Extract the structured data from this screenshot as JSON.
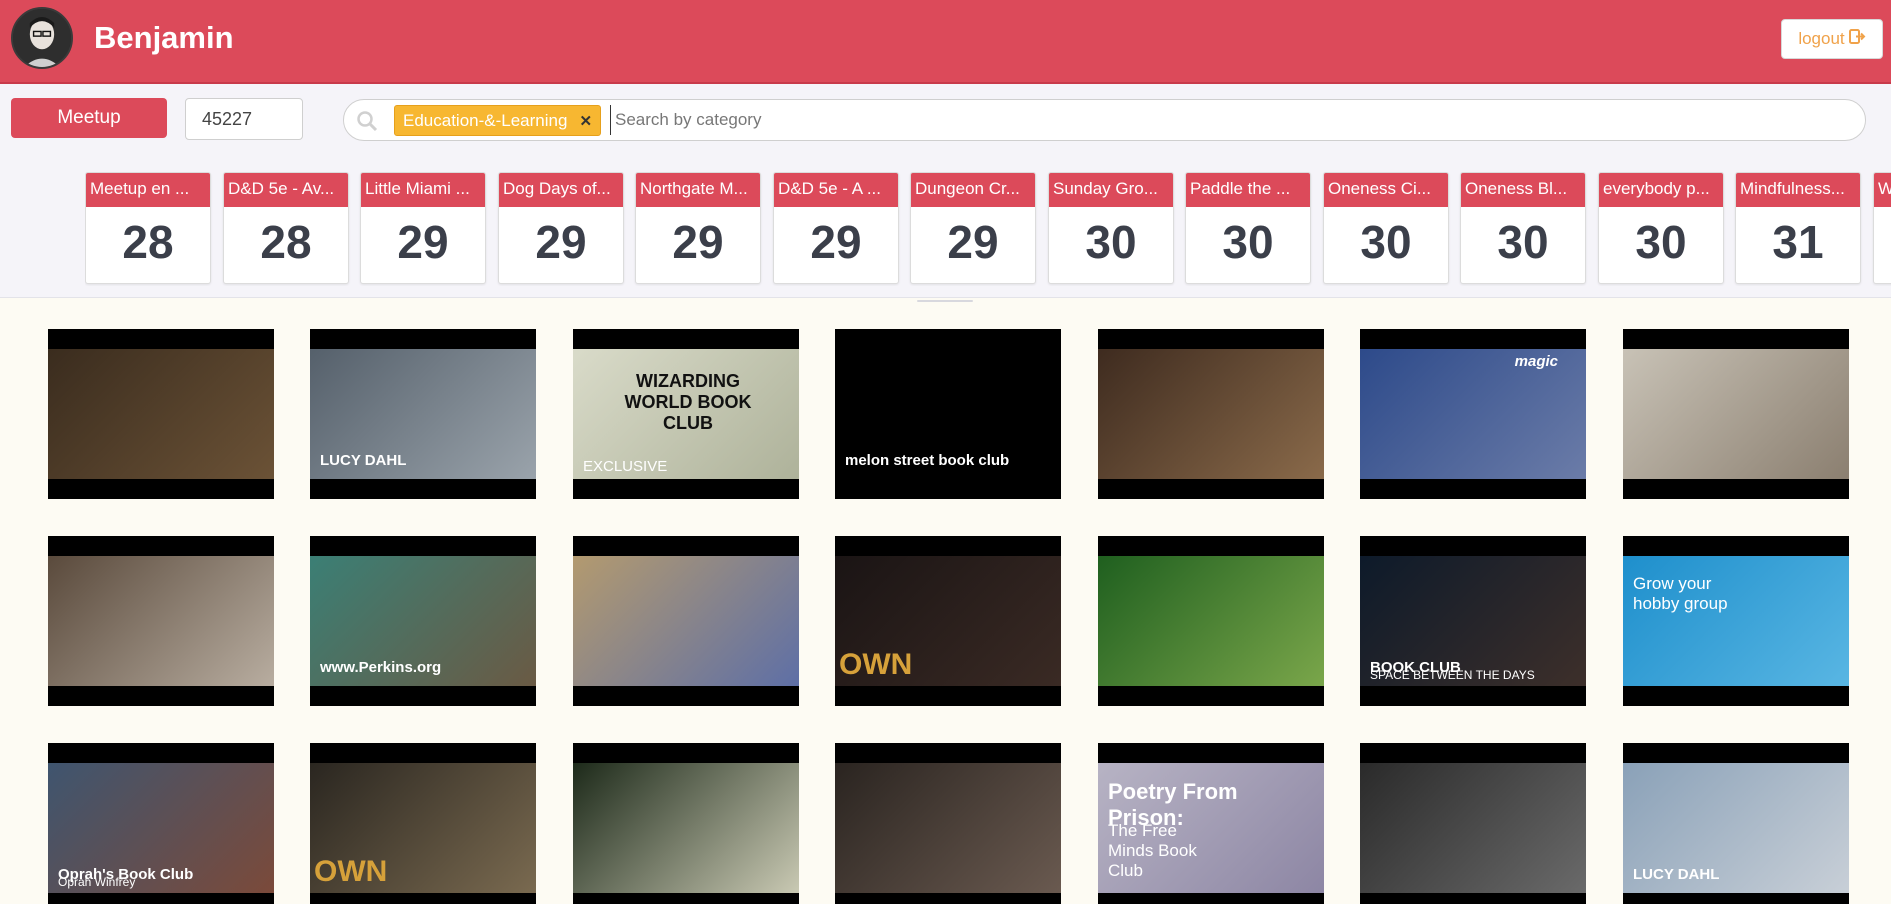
{
  "header": {
    "username": "Benjamin",
    "logout_label": "logout"
  },
  "toolbar": {
    "meetup_label": "Meetup",
    "zip_value": "45227",
    "search_tag": "Education-&-Learning",
    "search_placeholder": "Search by category"
  },
  "events": [
    {
      "title": "Meetup en ...",
      "day": "28"
    },
    {
      "title": "D&D 5e - Av...",
      "day": "28"
    },
    {
      "title": "Little Miami ...",
      "day": "29"
    },
    {
      "title": "Dog Days of...",
      "day": "29"
    },
    {
      "title": "Northgate M...",
      "day": "29"
    },
    {
      "title": "D&D 5e - A ...",
      "day": "29"
    },
    {
      "title": "Dungeon Cr...",
      "day": "29"
    },
    {
      "title": "Sunday Gro...",
      "day": "30"
    },
    {
      "title": "Paddle the ...",
      "day": "30"
    },
    {
      "title": "Oneness Ci...",
      "day": "30"
    },
    {
      "title": "Oneness Bl...",
      "day": "30"
    },
    {
      "title": "everybody p...",
      "day": "30"
    },
    {
      "title": "Mindfulness...",
      "day": "31"
    },
    {
      "title": "W",
      "day": ""
    }
  ],
  "videos": [
    {
      "caption": ""
    },
    {
      "caption": "LUCY DAHL"
    },
    {
      "caption": "WIZARDING WORLD BOOK CLUB",
      "sub": "EXCLUSIVE"
    },
    {
      "caption": "melon street book club"
    },
    {
      "caption": ""
    },
    {
      "caption": "magic"
    },
    {
      "caption": ""
    },
    {
      "caption": ""
    },
    {
      "caption": "www.Perkins.org"
    },
    {
      "caption": ""
    },
    {
      "caption": "OWN"
    },
    {
      "caption": ""
    },
    {
      "caption": "BOOK CLUB",
      "sub": "SPACE BETWEEN THE DAYS"
    },
    {
      "caption": "Grow your hobby group"
    },
    {
      "caption": "Oprah's Book Club",
      "sub": "Oprah Winfrey"
    },
    {
      "caption": "OWN"
    },
    {
      "caption": ""
    },
    {
      "caption": ""
    },
    {
      "caption": "Poetry From Prison:",
      "sub": "The Free Minds Book Club"
    },
    {
      "caption": ""
    },
    {
      "caption": "LUCY DAHL"
    }
  ]
}
